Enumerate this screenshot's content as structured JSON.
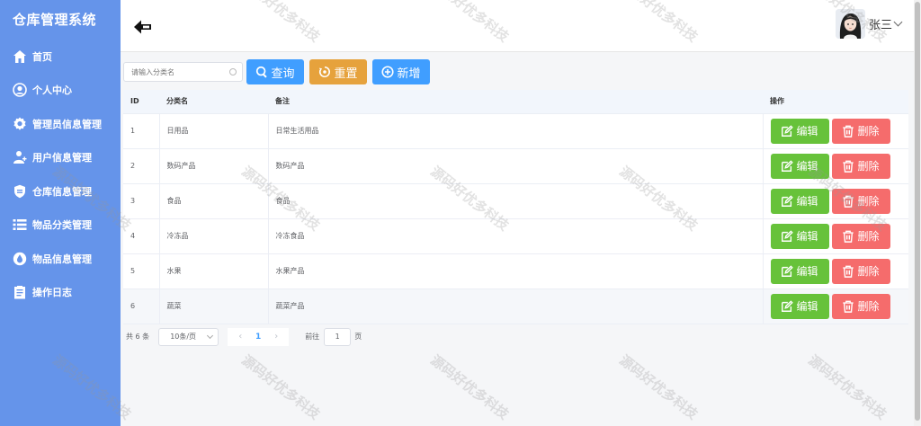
{
  "app": {
    "title": "仓库管理系统"
  },
  "sidebar": {
    "items": [
      {
        "label": "首页",
        "icon": "home-icon"
      },
      {
        "label": "个人中心",
        "icon": "person-icon"
      },
      {
        "label": "管理员信息管理",
        "icon": "gear-icon"
      },
      {
        "label": "用户信息管理",
        "icon": "user-add-icon"
      },
      {
        "label": "仓库信息管理",
        "icon": "shield-icon"
      },
      {
        "label": "物品分类管理",
        "icon": "list-icon"
      },
      {
        "label": "物品信息管理",
        "icon": "drop-icon"
      },
      {
        "label": "操作日志",
        "icon": "clipboard-icon"
      }
    ]
  },
  "header": {
    "username": "张三"
  },
  "toolbar": {
    "search_placeholder": "请输入分类名",
    "query_label": "查询",
    "reset_label": "重置",
    "add_label": "新增"
  },
  "table": {
    "columns": [
      "ID",
      "分类名",
      "备注",
      "操作"
    ],
    "rows": [
      {
        "id": "1",
        "name": "日用品",
        "note": "日常生活用品"
      },
      {
        "id": "2",
        "name": "数码产品",
        "note": "数码产品"
      },
      {
        "id": "3",
        "name": "食品",
        "note": "食品"
      },
      {
        "id": "4",
        "name": "冷冻品",
        "note": "冷冻食品"
      },
      {
        "id": "5",
        "name": "水果",
        "note": "水果产品"
      },
      {
        "id": "6",
        "name": "蔬菜",
        "note": "蔬菜产品"
      }
    ],
    "edit_label": "编辑",
    "delete_label": "删除"
  },
  "pagination": {
    "total_text": "共 6 条",
    "page_size": "10条/页",
    "current_page": "1",
    "goto_prefix": "前往",
    "goto_value": "1",
    "goto_suffix": "页"
  },
  "watermark": "源码好优多科技",
  "colors": {
    "sidebar": "#6594ea",
    "primary": "#409eff",
    "warning": "#e6a23c",
    "success": "#67c23a",
    "danger": "#f56c6c"
  }
}
